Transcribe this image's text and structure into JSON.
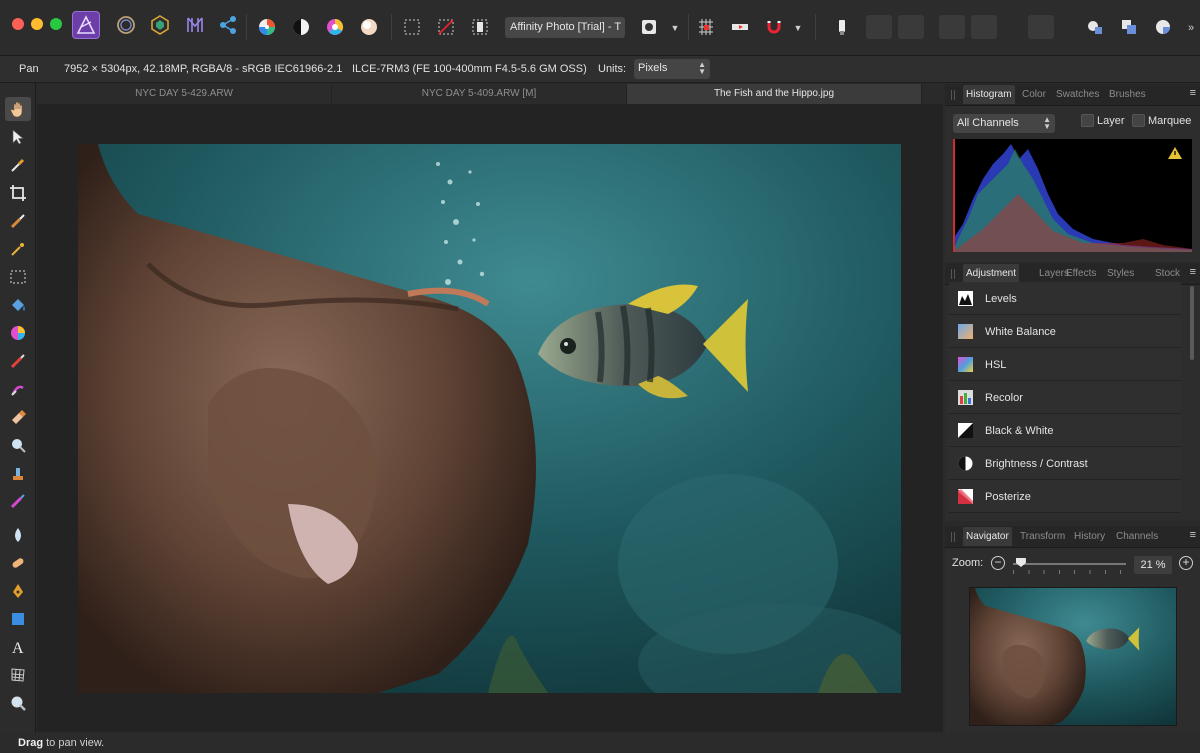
{
  "app": {
    "document_title": "Affinity Photo [Trial] - T",
    "persona_icons": [
      "photo-persona-icon",
      "liquify-persona-icon",
      "develop-persona-icon",
      "tone-mapping-persona-icon",
      "export-persona-icon"
    ]
  },
  "context_bar": {
    "tool_name": "Pan",
    "doc_info": "7952 × 5304px, 42.18MP, RGBA/8 - sRGB IEC61966-2.1",
    "camera_info": "ILCE-7RM3 (FE 100-400mm F4.5-5.6 GM OSS)",
    "units_label": "Units:",
    "units_value": "Pixels"
  },
  "document_tabs": [
    {
      "label": "NYC DAY 5-429.ARW",
      "active": false
    },
    {
      "label": "NYC DAY 5-409.ARW [M]",
      "active": false
    },
    {
      "label": "The Fish and the Hippo.jpg",
      "active": true
    }
  ],
  "histogram_panel": {
    "tabs": [
      "Histogram",
      "Color",
      "Swatches",
      "Brushes"
    ],
    "channel_select": "All Channels",
    "layer_label": "Layer",
    "marquee_label": "Marquee",
    "layer_checked": false,
    "marquee_checked": false
  },
  "adjustment_panel": {
    "tabs": [
      "Adjustment",
      "Layers",
      "Effects",
      "Styles",
      "Stock"
    ],
    "items": [
      {
        "label": "Levels",
        "icon": "levels-icon"
      },
      {
        "label": "White Balance",
        "icon": "white-balance-icon"
      },
      {
        "label": "HSL",
        "icon": "hsl-icon"
      },
      {
        "label": "Recolor",
        "icon": "recolor-icon"
      },
      {
        "label": "Black & White",
        "icon": "black-white-icon"
      },
      {
        "label": "Brightness / Contrast",
        "icon": "brightness-contrast-icon"
      },
      {
        "label": "Posterize",
        "icon": "posterize-icon"
      }
    ]
  },
  "navigator_panel": {
    "tabs": [
      "Navigator",
      "Transform",
      "History",
      "Channels"
    ],
    "zoom_label": "Zoom:",
    "zoom_value": "21 %",
    "zoom_fraction": 0.07
  },
  "status_bar": {
    "bold": "Drag",
    "text": " to pan view."
  },
  "colors": {
    "accent_purple": "#6c3ea8",
    "panel_bg": "#2d2d2d",
    "canvas_bg": "#232323"
  }
}
